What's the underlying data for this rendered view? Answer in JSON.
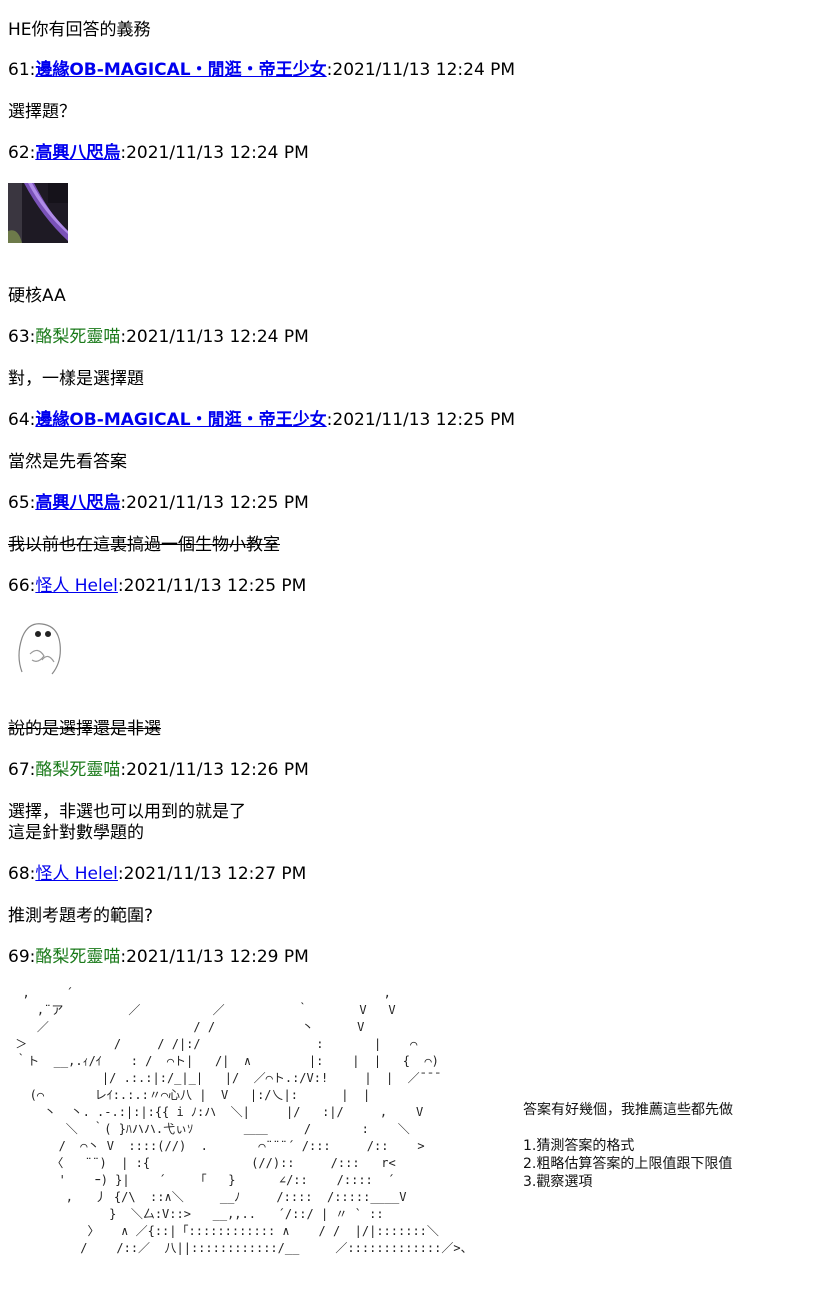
{
  "posts": [
    {
      "text": "HE你有回答的義務"
    },
    {
      "num": "61:",
      "name": "邊緣OB-MAGICAL・閒逛・帝王少女",
      "time": ":2021/11/13 12:24 PM"
    },
    {
      "text": "選擇題？"
    },
    {
      "num": "62:",
      "name": "高興八咫烏",
      "time": ":2021/11/13 12:24 PM"
    },
    {
      "text": "硬核AA"
    },
    {
      "num": "63:",
      "name": "酪梨死靈喵",
      "time": ":2021/11/13 12:24 PM"
    },
    {
      "text": "對，一樣是選擇題"
    },
    {
      "num": "64:",
      "name": "邊緣OB-MAGICAL・閒逛・帝王少女",
      "time": ":2021/11/13 12:25 PM"
    },
    {
      "text": "當然是先看答案"
    },
    {
      "num": "65:",
      "name": "高興八咫烏",
      "time": ":2021/11/13 12:25 PM"
    },
    {
      "text": "我以前也在這裏搞過一個生物小教室"
    },
    {
      "num": "66:",
      "name": "怪人 Helel",
      "time": ":2021/11/13 12:25 PM"
    },
    {
      "text": "說的是選擇還是非選"
    },
    {
      "num": "67:",
      "name": "酪梨死靈喵",
      "time": ":2021/11/13 12:26 PM"
    },
    {
      "text1": "選擇，非選也可以用到的就是了",
      "text2": "這是針對數學題的"
    },
    {
      "num": "68:",
      "name": "怪人 Helel",
      "time": ":2021/11/13 12:27 PM"
    },
    {
      "text": "推測考題考的範圍?"
    },
    {
      "num": "69:",
      "name": "酪梨死靈喵",
      "time": ":2021/11/13 12:29 PM"
    }
  ],
  "side_note": {
    "line1": "答案有好幾個，我推薦這些都先做",
    "line2": "1.猜測答案的格式",
    "line3": "2.粗略估算答案的上限值跟下限值",
    "line4": "3.觀察選項"
  },
  "ascii_art": "  ,     ´                                           ,\n    ,¨ア         ／          ／          ｀       V   V\n    ／                    / /            丶      V\n ＞            /     / /|:/                :       |    ⌒\n ｀ト  __,.ｨ/ｲ    : /  ⌒ト|   /|  ∧        |:    |  |   {  ⌒)\n             |/ .:.:|:/_|_|   |/  ／⌒ト.:/V:!     |  |  ／¯¯¯\n   (⌒       レｲ:.:.:〃⌒心八 |  V   |:/乀|:      |  |\n     丶  丶. .-.:|:|:{{ i ﾉ:ハ  ＼|     |/   :|/     ,    V\n        ＼  ｀( }ﾊハハ.弋ぃｿ       ＿＿     /       :    ＼\n       /  ⌒丶 V  ::::(//)  .       ⌒¨¨¨´ /:::     /::    >\n      〈   ¨¨)  | :{              (//)::     /:::   r<\n       '    ｰ) }|    ´    「   }      ∠/::    /::::  ´\n        ,   丿 {/\\  ::∧＼     __ﾉ     /::::  /:::::____V\n              }  ＼厶:V::>   __,,..   ´/::/ | 〃 ` ::\n           〉   ∧ ／{::|「:::::::::::: ∧    / /  |/|:::::::＼\n          /    /::／  八||::::::::::::/__     ／:::::::::::::／>、"
}
